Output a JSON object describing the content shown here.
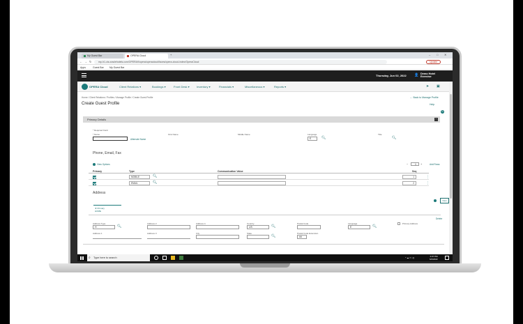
{
  "browser": {
    "tabs": [
      {
        "label": "My Guest Bar",
        "active": false
      },
      {
        "label": "OPERA Cloud",
        "active": true
      }
    ],
    "new_tab": "+",
    "url": "mp-h1-cis.oraclehotels.com/OPERA9/opera/operacloud/faces/opera-cloud-index/OperaCloud",
    "update_label": "Update",
    "bookmarks": [
      "Apps",
      "Guest Bar",
      "My Guest Bar"
    ],
    "window_controls": {
      "min": "–",
      "max": "□",
      "close": "✕"
    }
  },
  "app": {
    "date": "Thursday, Jun 02, 2022",
    "hotel_line1": "Demo Hotel",
    "hotel_line2": "Exercise",
    "brand": "OPERA Cloud",
    "nav": [
      "Client Relations ▾",
      "Bookings ▾",
      "Front Desk ▾",
      "Inventory ▾",
      "Financials ▾",
      "Miscellaneous ▾",
      "Reports ▾"
    ],
    "breadcrumb": "Home / Client Relations / Profiles / Manage Profile / Create Guest Profile",
    "back_link": "← Back to Manage Profile",
    "page_title": "Create Guest Profile",
    "help": "Help",
    "section_title": "Primary Details",
    "collapse_icon": "−",
    "required_note": "* Required Field",
    "labels": {
      "name": "* Name",
      "first_name": "First Name",
      "middle_name": "Middle Name",
      "language": "Language",
      "title": "Title",
      "alternate_name": "Alternate Name"
    },
    "language_value": "E",
    "phone_heading": "Phone, Email, Fax",
    "view_options": "View Options",
    "stepper": {
      "minus": "−",
      "value": "1",
      "plus": "+"
    },
    "add_rows": "Add Rows",
    "table": {
      "headers": [
        "Primary",
        "Type",
        "Communication Value",
        "Seq"
      ],
      "rows": [
        {
          "type": "MOBILE",
          "value": "",
          "seq": "1"
        },
        {
          "type": "EMAIL",
          "value": "",
          "seq": "2"
        }
      ]
    },
    "address_heading": "Address",
    "address_tab": "★ Primary\nHOME",
    "new_button": "New",
    "delete_link": "Delete",
    "address_labels": {
      "address_type": "Address Type",
      "address2": "Address 2",
      "address4": "Address 4",
      "country": "Country",
      "postal_code": "Postal Code",
      "language": "Language",
      "primary_address": "Primary Address",
      "address1": "Address 1",
      "address3": "Address 3",
      "city": "City",
      "state": "State",
      "postal_ext": "Postal Code Extension"
    },
    "address_values": {
      "address_type": "H",
      "country": "US",
      "language": "E",
      "postal_ext": "##"
    }
  },
  "taskbar": {
    "search_placeholder": "Type here to search",
    "tray": "^ ☁ ▭ ◁)",
    "time": "4:07 PM",
    "date": "6/2/2022"
  }
}
